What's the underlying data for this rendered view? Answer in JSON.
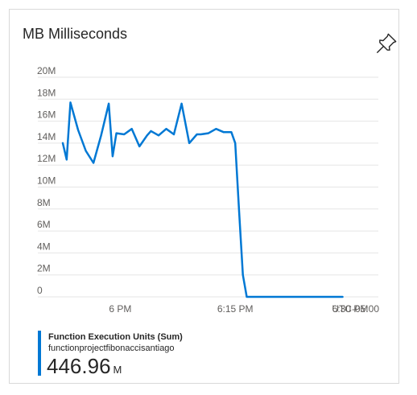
{
  "card": {
    "title": "MB Milliseconds"
  },
  "icons": {
    "pin": "pin-icon"
  },
  "colors": {
    "series": "#0078d4",
    "grid": "#e5e5e5",
    "axis_text": "#605e5c"
  },
  "chart_data": {
    "type": "line",
    "title": "MB Milliseconds",
    "xlabel": "",
    "ylabel": "",
    "timezone_label": "UTC-05:00",
    "x_ticks": [
      "6 PM",
      "6:15 PM",
      "6:30 PM"
    ],
    "ylim": [
      0,
      20
    ],
    "y_ticks": [
      {
        "value": 0,
        "label": "0"
      },
      {
        "value": 2,
        "label": "2M"
      },
      {
        "value": 4,
        "label": "4M"
      },
      {
        "value": 6,
        "label": "6M"
      },
      {
        "value": 8,
        "label": "8M"
      },
      {
        "value": 10,
        "label": "10M"
      },
      {
        "value": 12,
        "label": "12M"
      },
      {
        "value": 14,
        "label": "14M"
      },
      {
        "value": 16,
        "label": "16M"
      },
      {
        "value": 18,
        "label": "18M"
      },
      {
        "value": 20,
        "label": "20M"
      }
    ],
    "x_unit": "minutes relative to 6 PM",
    "xlim": [
      -7.5,
      30
    ],
    "grid": true,
    "series": [
      {
        "name": "Function Execution Units (Sum)",
        "x": [
          -7.5,
          -7,
          -6.5,
          -5.5,
          -4.5,
          -3.5,
          -2.5,
          -1.5,
          -1,
          -0.5,
          0.5,
          1.5,
          2.5,
          3.5,
          4,
          5,
          6,
          7,
          8,
          9,
          10,
          10.5,
          11.5,
          12.5,
          13.5,
          14.5,
          15,
          15.5,
          16,
          16.5,
          17,
          17.5,
          18,
          29
        ],
        "y": [
          14.0,
          12.5,
          17.7,
          15.2,
          13.3,
          12.2,
          14.7,
          17.6,
          12.8,
          14.9,
          14.8,
          15.3,
          13.7,
          14.7,
          15.1,
          14.7,
          15.3,
          14.8,
          17.6,
          14.0,
          14.8,
          14.8,
          14.9,
          15.3,
          15.0,
          15.0,
          14.0,
          7.8,
          2.0,
          0,
          0,
          0,
          0,
          0
        ]
      }
    ],
    "legend": {
      "series_name": "Function Execution Units (Sum)",
      "resource": "functionprojectfibonaccisantiago",
      "value": "446.96",
      "unit": "M"
    }
  }
}
